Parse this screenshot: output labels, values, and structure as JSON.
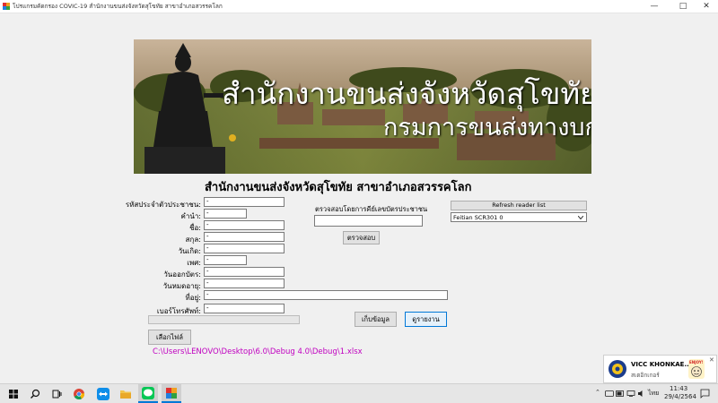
{
  "window": {
    "title": "โปรแกรมคัดกรอง COVIC-19 สำนักงานขนส่งจังหวัดสุโขทัย สาขาอำเภอสวรรคโลก",
    "minimize": "—",
    "maximize": "□",
    "close": "✕"
  },
  "banner": {
    "line1": "สำนักงานขนส่งจังหวัดสุโขทัย",
    "line2": "กรมการขนส่งทางบก"
  },
  "form": {
    "title": "สำนักงานขนส่งจังหวัดสุโขทัย สาขาอำเภอสวรรคโลก",
    "labels": {
      "citizen_id": "รหัสประจำตัวประชาชน:",
      "prefix": "คำนำ:",
      "first_name": "ชื่อ:",
      "last_name": "สกุล:",
      "birth_date": "วันเกิด:",
      "gender": "เพศ:",
      "issue_date": "วันออกบัตร:",
      "expire_date": "วันหมดอายุ:",
      "address": "ที่อยู่:",
      "phone": "เบอร์โทรศัพท์:"
    },
    "values": {
      "citizen_id": "-",
      "prefix": "-",
      "first_name": "-",
      "last_name": "-",
      "birth_date": "-",
      "gender": "-",
      "issue_date": "-",
      "expire_date": "-",
      "address": "-",
      "phone": "-"
    },
    "verify_label": "ตรวจสอบโดยการคีย์เลขบัตรประชาชน",
    "verify_input": "",
    "verify_button": "ตรวจสอบ",
    "refresh_button": "Refresh reader list",
    "reader_selected": "Feitian SCR301 0",
    "save_button": "เก็บข้อมูล",
    "report_button": "ดูรายงาน",
    "choose_file_button": "เลือกไฟล์",
    "file_path": "C:\\Users\\LENOVO\\Desktop\\6.0\\Debug 4.0\\Debug\\1.xlsx"
  },
  "notification": {
    "title": "VICC KHONKAE...",
    "subtitle": "สเตอิกเกอร์",
    "badge": "ENJOY!",
    "close": "✕"
  },
  "taskbar": {
    "lang": "ไทย",
    "time": "11:43",
    "date": "29/4/2564"
  },
  "colors": {
    "accent": "#0078d7",
    "path_text": "#c000c0"
  }
}
